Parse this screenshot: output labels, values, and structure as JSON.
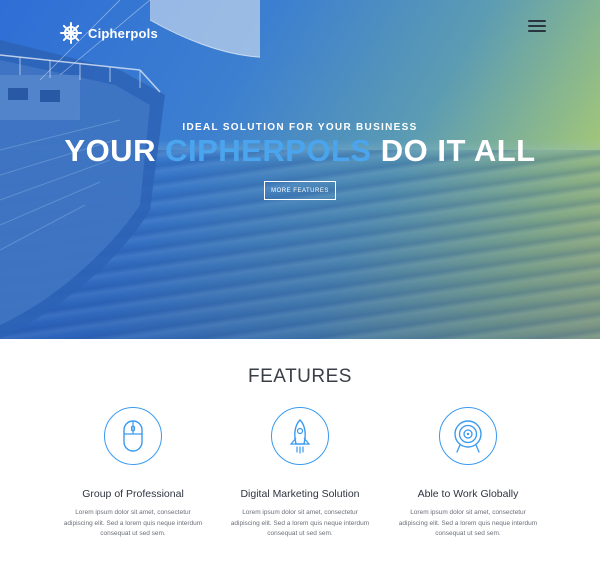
{
  "header": {
    "logo_text": "Cipherpols",
    "logo_icon": "ship-wheel-icon",
    "menu_icon": "hamburger-menu-icon"
  },
  "hero": {
    "tagline": "IDEAL SOLUTION FOR YOUR BUSINESS",
    "headline_part1": "YOUR ",
    "headline_accent": "CIPHERPOLS",
    "headline_part2": " DO IT ALL",
    "button_label": "MORE FEATURES",
    "accent_color": "#4aa5ee"
  },
  "features": {
    "title": "FEATURES",
    "items": [
      {
        "icon": "mouse-icon",
        "title": "Group of Professional",
        "text": "Lorem ipsum dolor sit amet, consectetur adipiscing elit. Sed a lorem quis neque interdum consequat ut sed sem."
      },
      {
        "icon": "rocket-icon",
        "title": "Digital Marketing Solution",
        "text": "Lorem ipsum dolor sit amet, consectetur adipiscing elit. Sed a lorem quis neque interdum consequat ut sed sem."
      },
      {
        "icon": "target-icon",
        "title": "Able to Work Globally",
        "text": "Lorem ipsum dolor sit amet, consectetur adipiscing elit. Sed a lorem quis neque interdum consequat ut sed sem."
      }
    ],
    "icon_color": "#3a9af0"
  }
}
